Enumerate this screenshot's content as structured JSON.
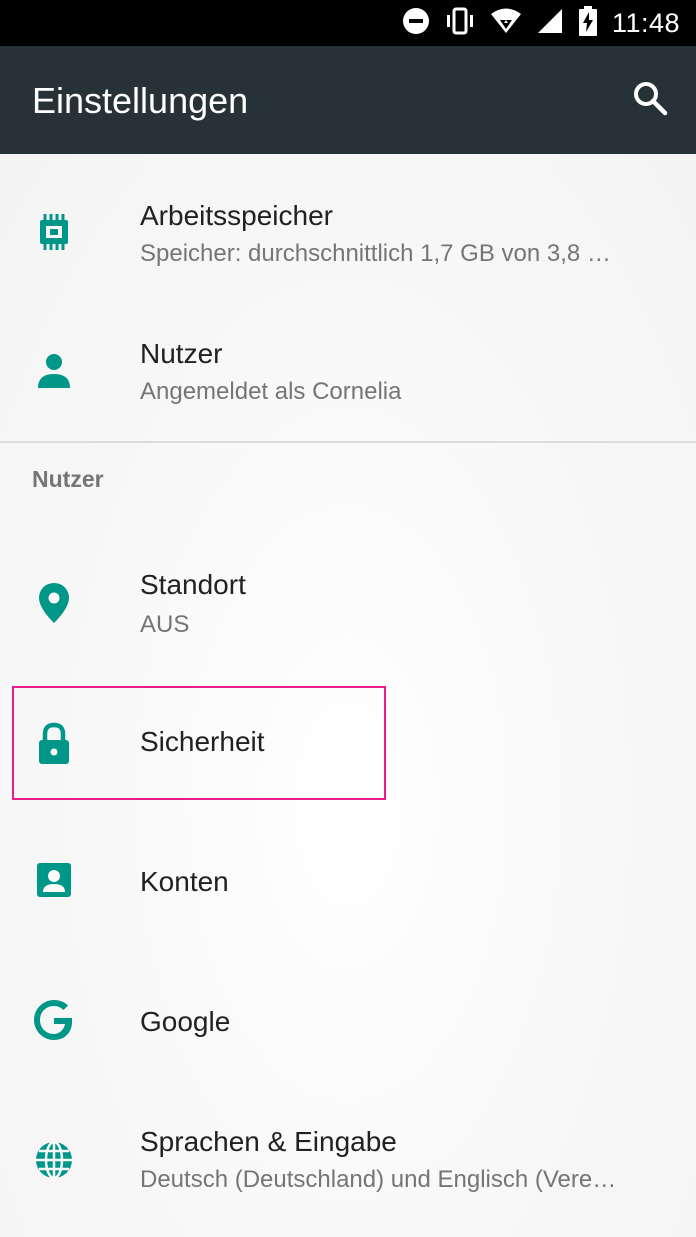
{
  "status_bar": {
    "time": "11:48",
    "icons": [
      "do-not-disturb-icon",
      "vibrate-icon",
      "wifi-icon",
      "cell-signal-icon",
      "battery-charging-icon"
    ]
  },
  "app_bar": {
    "title": "Einstellungen",
    "search_icon": "search-icon"
  },
  "items": [
    {
      "title": "Arbeitsspeicher",
      "summary": "Speicher: durchschnittlich 1,7 GB von 3,8 …",
      "icon": "memory-icon"
    },
    {
      "title": "Nutzer",
      "summary": "Angemeldet als Cornelia",
      "icon": "person-icon"
    }
  ],
  "category": "Nutzer",
  "category_items": [
    {
      "title": "Standort",
      "summary": "AUS",
      "icon": "location-icon"
    },
    {
      "title": "Sicherheit",
      "icon": "lock-icon"
    },
    {
      "title": "Konten",
      "icon": "account-box-icon"
    },
    {
      "title": "Google",
      "icon": "google-icon"
    },
    {
      "title": "Sprachen & Eingabe",
      "summary": "Deutsch (Deutschland) und Englisch (Vere…",
      "icon": "language-icon"
    }
  ],
  "colors": {
    "accent": "#009688",
    "app_bar": "#263238",
    "highlight": "#e91e8c"
  }
}
